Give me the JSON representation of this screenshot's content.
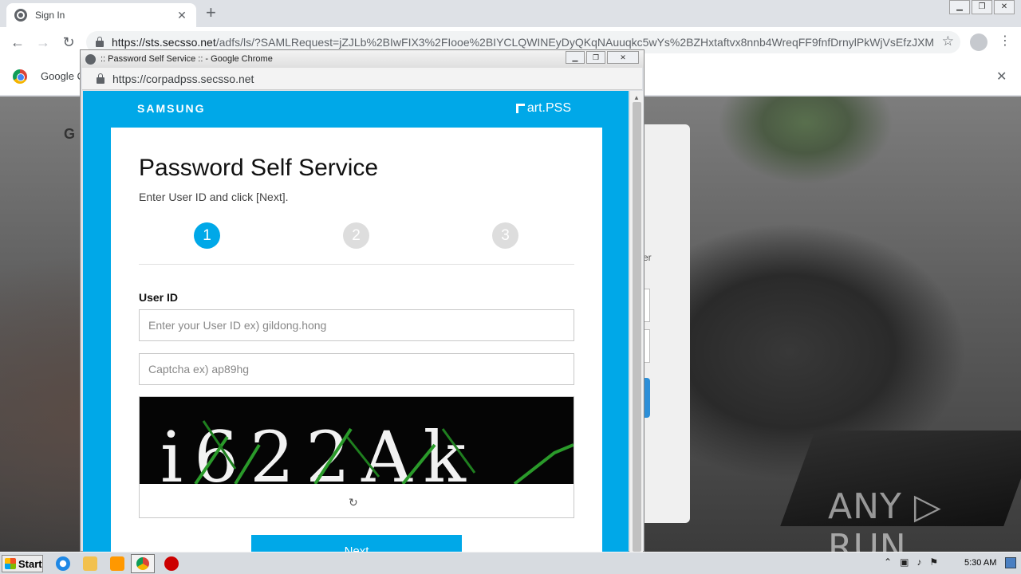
{
  "browser": {
    "tab_title": "Sign In",
    "url_host": "https://sts.secsso.net",
    "url_rest": "/adfs/ls/?SAMLRequest=jZJLb%2BIwFIX3%2FIooe%2BIYCLQWINEyDyQKqNAuuqkc5wYs%2BZHxtaftvx8nnb4WreqFF9fnfDrnylPkWjVsEfzJXM...",
    "infobar_text": "Google C"
  },
  "popup": {
    "window_title": ":: Password Self Service :: - Google Chrome",
    "url": "https://corpadpss.secsso.net",
    "brand_left": "SAMSUNG",
    "brand_right": "art.PSS",
    "title": "Password Self Service",
    "subtitle": "Enter User ID and click [Next].",
    "steps": [
      "1",
      "2",
      "3"
    ],
    "user_id_label": "User ID",
    "user_id_placeholder": "Enter your User ID ex) gildong.hong",
    "captcha_placeholder": "Captcha ex) ap89hg",
    "captcha_text": "i622Ak",
    "refresh_icon": "↻",
    "next_label": "Next"
  },
  "background_page": {
    "letter": "G",
    "card_fragment": "er"
  },
  "watermark": "ANY ▷ RUN",
  "taskbar": {
    "start_label": "Start",
    "clock": "5:30 AM"
  },
  "colors": {
    "accent": "#00a8e8",
    "step_inactive": "#dddddd"
  }
}
